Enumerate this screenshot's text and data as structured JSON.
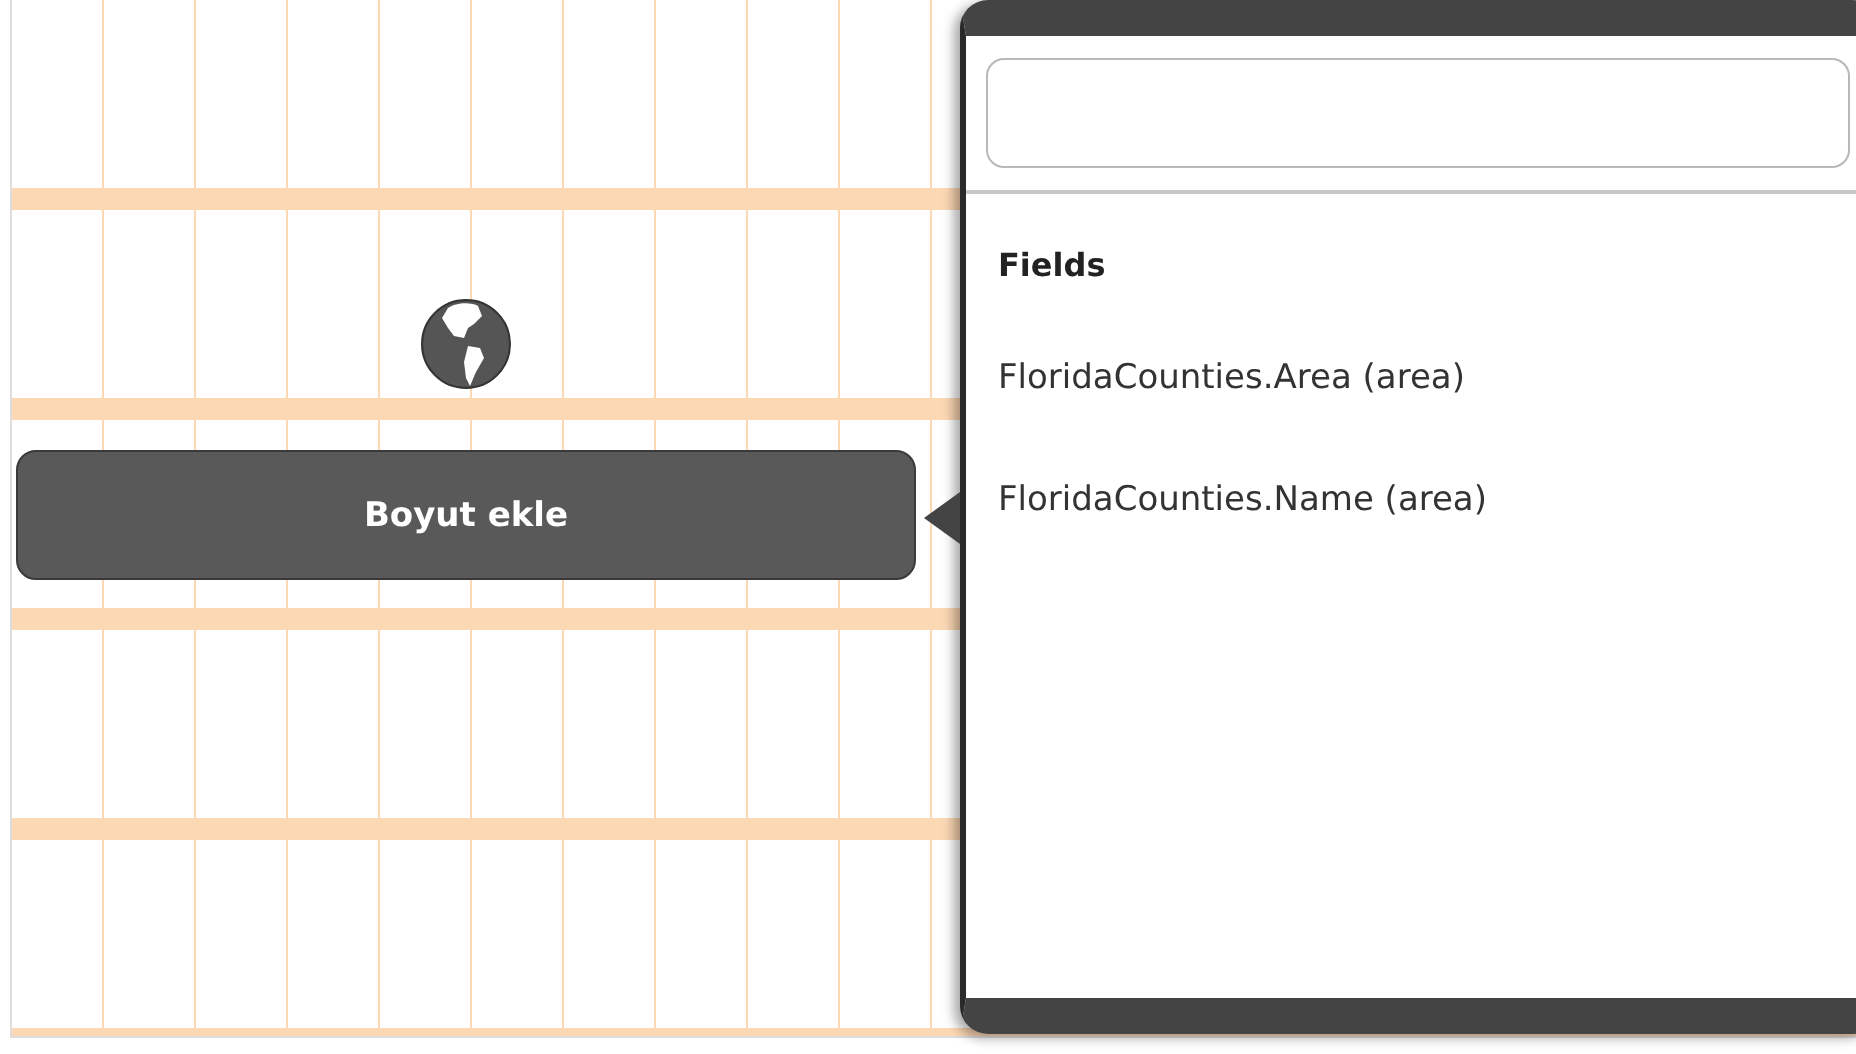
{
  "canvas": {
    "add_button": {
      "label": "Boyut ekle"
    }
  },
  "field_picker": {
    "heading": "Fields",
    "items": [
      {
        "label": "FloridaCounties.Area (area)"
      },
      {
        "label": "FloridaCounties.Name (area)"
      }
    ]
  }
}
